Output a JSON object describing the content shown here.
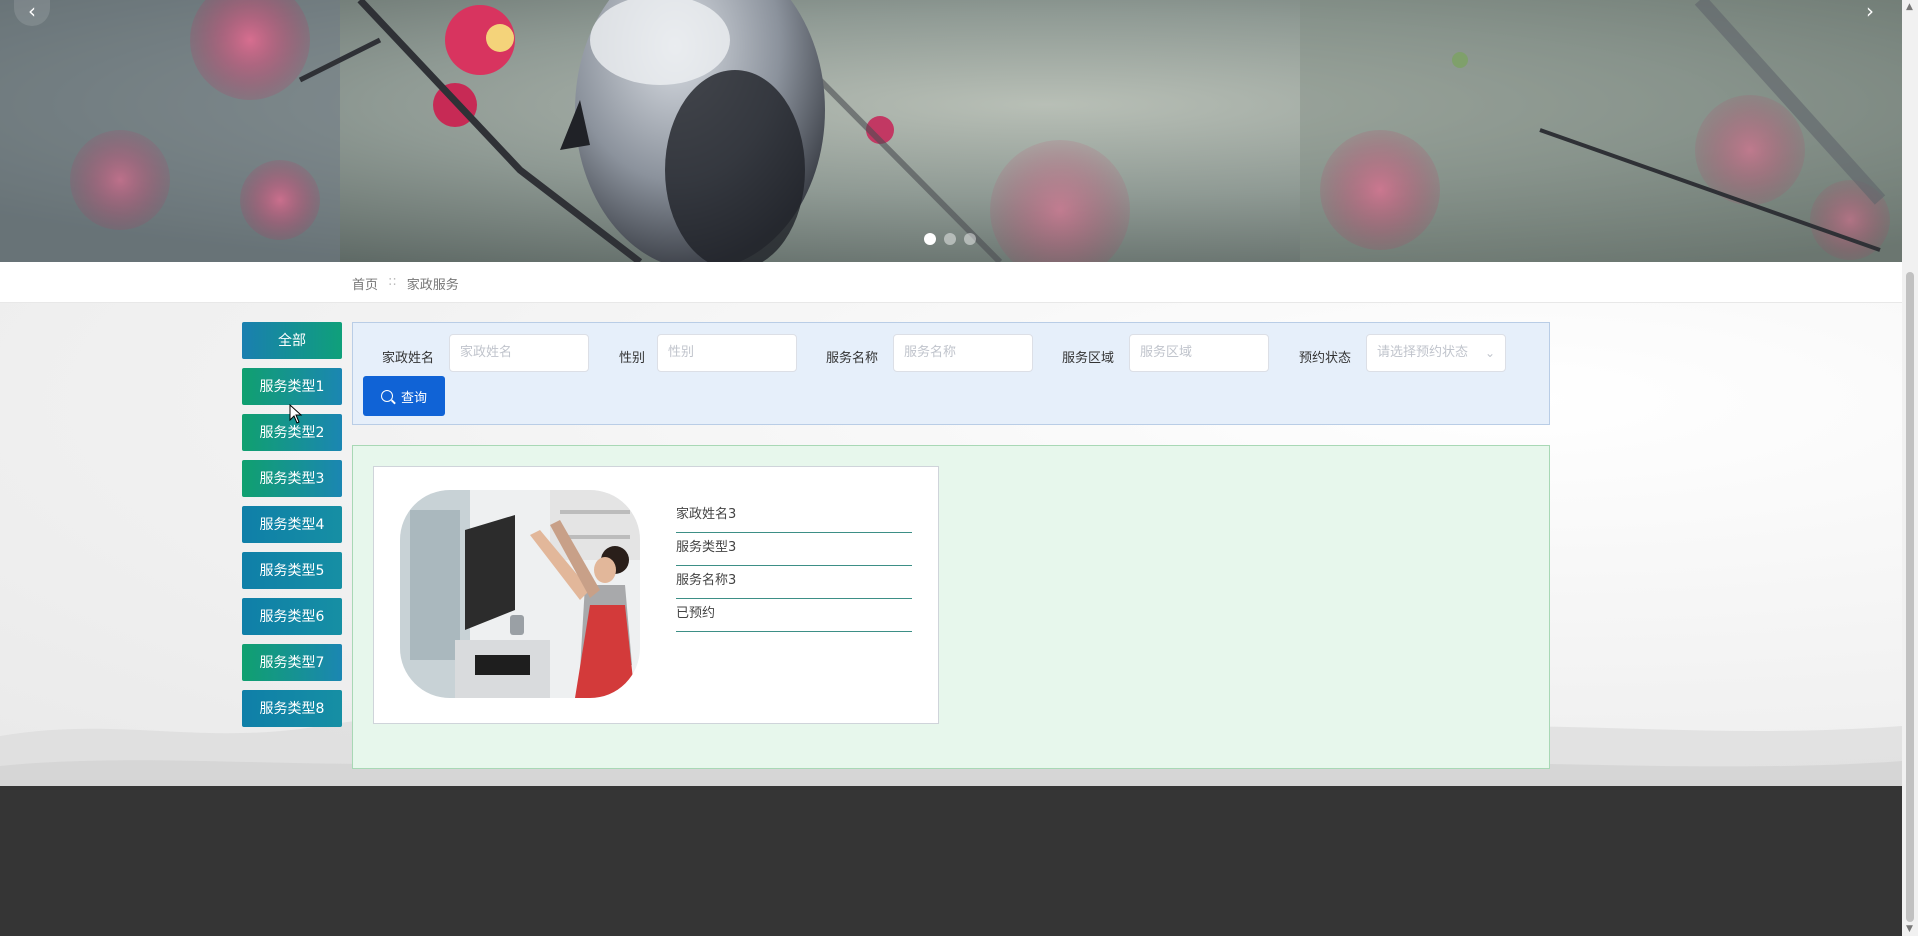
{
  "banner": {
    "prev_icon": "chevron-left-icon",
    "next_icon": "chevron-right-icon",
    "prev_glyph": "‹",
    "next_glyph": "›",
    "slide_count": 3,
    "active_slide": 1
  },
  "breadcrumb": {
    "home": "首页",
    "separator": "::",
    "current": "家政服务"
  },
  "sidebar": {
    "items": [
      {
        "label": "全部"
      },
      {
        "label": "服务类型1"
      },
      {
        "label": "服务类型2"
      },
      {
        "label": "服务类型3"
      },
      {
        "label": "服务类型4"
      },
      {
        "label": "服务类型5"
      },
      {
        "label": "服务类型6"
      },
      {
        "label": "服务类型7"
      },
      {
        "label": "服务类型8"
      }
    ]
  },
  "search": {
    "name_label": "家政姓名",
    "name_placeholder": "家政姓名",
    "gender_label": "性别",
    "gender_placeholder": "性别",
    "service_label": "服务名称",
    "service_placeholder": "服务名称",
    "area_label": "服务区域",
    "area_placeholder": "服务区域",
    "status_label": "预约状态",
    "status_placeholder": "请选择预约状态",
    "button_label": "查询"
  },
  "results": [
    {
      "name": "家政姓名3",
      "type": "服务类型3",
      "service": "服务名称3",
      "status": "已预约"
    }
  ],
  "colors": {
    "primary_button": "#1063d6",
    "sidebar_gradient_start": "#1a7fb0",
    "sidebar_gradient_end": "#0fa07a",
    "search_panel_bg": "#e6effa",
    "list_panel_bg": "#e7f7ec",
    "footer_bg": "#353535"
  }
}
